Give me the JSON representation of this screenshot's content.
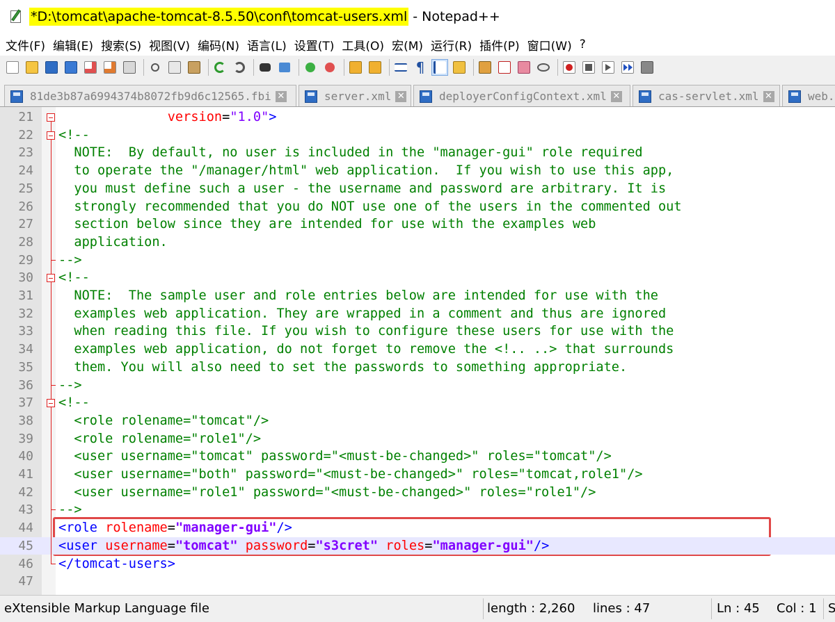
{
  "window": {
    "title_path": "*D:\\tomcat\\apache-tomcat-8.5.50\\conf\\tomcat-users.xml",
    "title_suffix": " - Notepad++"
  },
  "menu": [
    "文件(F)",
    "编辑(E)",
    "搜索(S)",
    "视图(V)",
    "编码(N)",
    "语言(L)",
    "设置(T)",
    "工具(O)",
    "宏(M)",
    "运行(R)",
    "插件(P)",
    "窗口(W)",
    "?"
  ],
  "tabs": [
    {
      "label": "81de3b87a6994374b8072fb9d6c12565.fbi",
      "close": "✕"
    },
    {
      "label": "server.xml",
      "close": "✕"
    },
    {
      "label": "deployerConfigContext.xml",
      "close": "✕"
    },
    {
      "label": "cas-servlet.xml",
      "close": "✕"
    },
    {
      "label": "web.",
      "close": ""
    }
  ],
  "editor": {
    "lines": [
      {
        "num": "21",
        "text": "              version=\"1.0\">"
      },
      {
        "num": "22",
        "text": "<!--"
      },
      {
        "num": "23",
        "text": "  NOTE:  By default, no user is included in the \"manager-gui\" role required"
      },
      {
        "num": "24",
        "text": "  to operate the \"/manager/html\" web application.  If you wish to use this app,"
      },
      {
        "num": "25",
        "text": "  you must define such a user - the username and password are arbitrary. It is"
      },
      {
        "num": "26",
        "text": "  strongly recommended that you do NOT use one of the users in the commented out"
      },
      {
        "num": "27",
        "text": "  section below since they are intended for use with the examples web"
      },
      {
        "num": "28",
        "text": "  application."
      },
      {
        "num": "29",
        "text": "-->"
      },
      {
        "num": "30",
        "text": "<!--"
      },
      {
        "num": "31",
        "text": "  NOTE:  The sample user and role entries below are intended for use with the"
      },
      {
        "num": "32",
        "text": "  examples web application. They are wrapped in a comment and thus are ignored"
      },
      {
        "num": "33",
        "text": "  when reading this file. If you wish to configure these users for use with the"
      },
      {
        "num": "34",
        "text": "  examples web application, do not forget to remove the <!.. ..> that surrounds"
      },
      {
        "num": "35",
        "text": "  them. You will also need to set the passwords to something appropriate."
      },
      {
        "num": "36",
        "text": "-->"
      },
      {
        "num": "37",
        "text": "<!--"
      },
      {
        "num": "38",
        "text": "  <role rolename=\"tomcat\"/>"
      },
      {
        "num": "39",
        "text": "  <role rolename=\"role1\"/>"
      },
      {
        "num": "40",
        "text": "  <user username=\"tomcat\" password=\"<must-be-changed>\" roles=\"tomcat\"/>"
      },
      {
        "num": "41",
        "text": "  <user username=\"both\" password=\"<must-be-changed>\" roles=\"tomcat,role1\"/>"
      },
      {
        "num": "42",
        "text": "  <user username=\"role1\" password=\"<must-be-changed>\" roles=\"role1\"/>"
      },
      {
        "num": "43",
        "text": "-->"
      },
      {
        "num": "44",
        "text": ""
      },
      {
        "num": "45",
        "text": ""
      },
      {
        "num": "46",
        "text": "</tomcat-users>"
      },
      {
        "num": "47",
        "text": ""
      }
    ],
    "line21_attr": "version",
    "line21_val": "\"1.0\"",
    "line21_close": ">",
    "line44": {
      "open": "<role",
      "attr": "rolename",
      "val": "\"manager-gui\"",
      "close": "/>"
    },
    "line45": {
      "open": "<user",
      "attr1": "username",
      "val1": "\"tomcat\"",
      "attr2": "password",
      "val2": "\"s3cret\"",
      "attr3": "roles",
      "val3": "\"manager-gui\"",
      "close": "/>"
    },
    "line46": "</tomcat-users>"
  },
  "status": {
    "filetype": "eXtensible Markup Language file",
    "length": "length : 2,260",
    "lines": "lines : 47",
    "ln": "Ln : 45",
    "col": "Col : 1",
    "extra": "S"
  }
}
